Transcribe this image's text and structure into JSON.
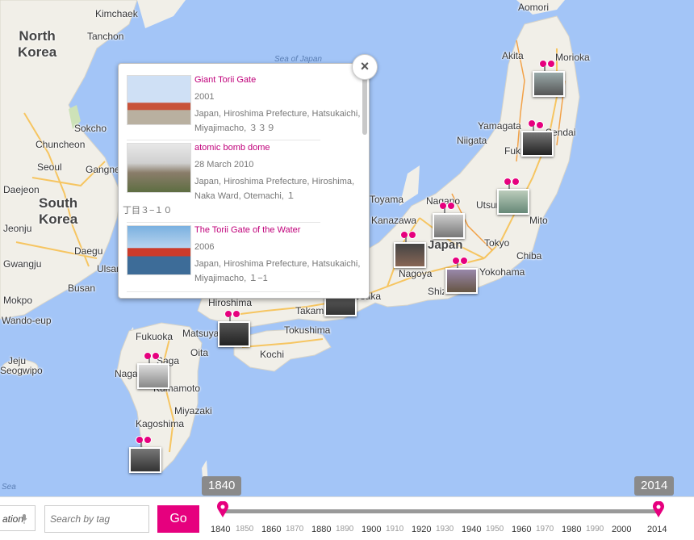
{
  "map": {
    "countries": [
      {
        "id": "north-korea",
        "lines": [
          "North",
          "Korea"
        ]
      },
      {
        "id": "south-korea",
        "lines": [
          "South",
          "Korea"
        ]
      },
      {
        "id": "japan",
        "lines": [
          "Japan"
        ]
      }
    ],
    "sea_label": "Sea of Japan",
    "corner_label": "Sea",
    "cities": [
      "Kimchaek",
      "Tanchon",
      "Sokcho",
      "Chuncheon",
      "Seoul",
      "Gangneung",
      "Daejeon",
      "Jeonju",
      "Daegu",
      "Ulsan",
      "Gwangju",
      "Busan",
      "Mokpo",
      "Wando-eup",
      "Jeju",
      "Seogwipo",
      "Aomori",
      "Akita",
      "Morioka",
      "Yamagata",
      "Sendai",
      "Fukushima",
      "Niigata",
      "Nagano",
      "Toyama",
      "Kanazawa",
      "Utsunomiya",
      "Mito",
      "Tokyo",
      "Chiba",
      "Yokohama",
      "Nagoya",
      "Shizuoka",
      "Osaka",
      "Takamatsu",
      "Tokushima",
      "Kochi",
      "Matsuyama",
      "Hiroshima",
      "Fukuoka",
      "Oita",
      "Saga",
      "Nagasaki",
      "Kumamoto",
      "Miyazaki",
      "Kagoshima"
    ]
  },
  "popup": {
    "entries": [
      {
        "title": "Giant Torii Gate",
        "date": "2001",
        "address": "Japan, Hiroshima Prefecture, Hatsukaichi, Miyajimacho, ３３９",
        "address_cont": ""
      },
      {
        "title": "atomic bomb dome",
        "date": "28 March 2010",
        "address": "Japan, Hiroshima Prefecture, Hiroshima, Naka Ward, Otemachi, １",
        "address_cont": "丁目３−１０"
      },
      {
        "title": "The Torii Gate of the Water",
        "date": "2006",
        "address": "Japan, Hiroshima Prefecture, Hatsukaichi, Miyajimacho, １−1",
        "address_cont": ""
      }
    ],
    "close_symbol": "×"
  },
  "search": {
    "location_placeholder": "ation",
    "tag_placeholder": "Search by tag",
    "go_label": "Go"
  },
  "timeline": {
    "start_year": "1840",
    "end_year": "2014",
    "major_ticks": [
      "1840",
      "1860",
      "1880",
      "1900",
      "1920",
      "1940",
      "1960",
      "1980",
      "2000",
      "2014"
    ],
    "minor_ticks": [
      "1850",
      "1870",
      "1890",
      "1910",
      "1930",
      "1950",
      "1970",
      "1990"
    ]
  },
  "colors": {
    "accent": "#e6007e",
    "sea": "#a3c5f7",
    "land": "#f1efe8",
    "road": "#f6c561",
    "highway": "#f2a248"
  }
}
